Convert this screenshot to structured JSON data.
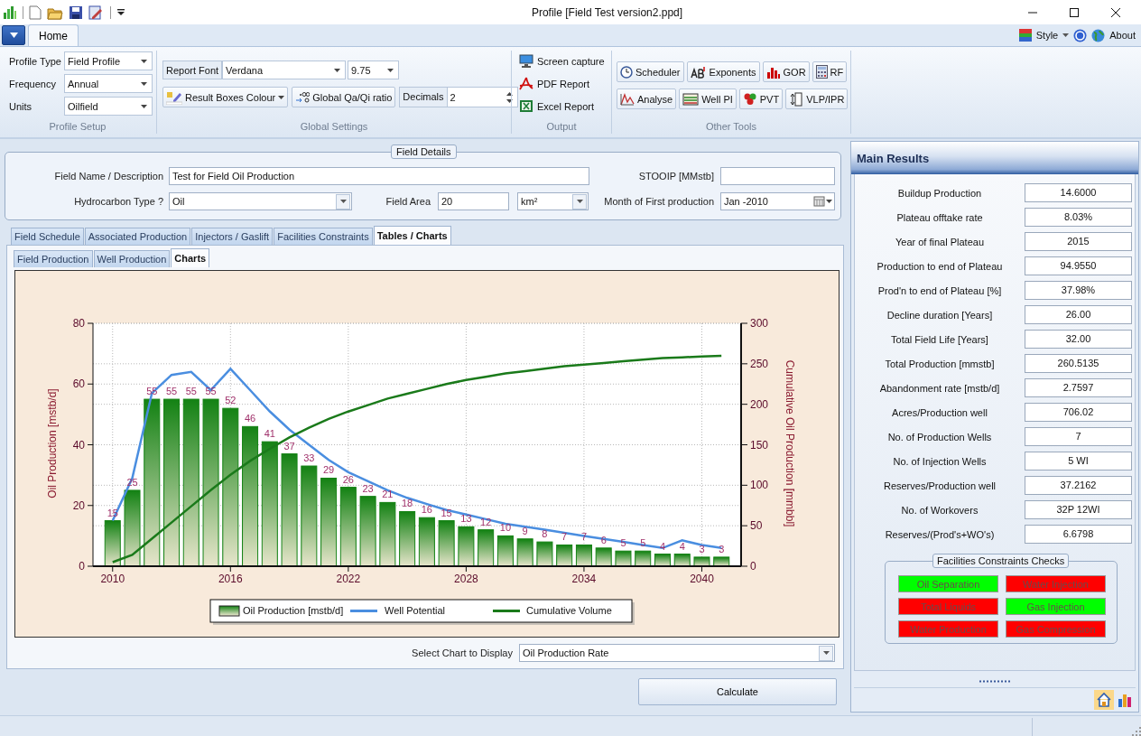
{
  "window": {
    "title": "Profile [Field Test version2.ppd]"
  },
  "ribbon": {
    "tabs": [
      {
        "label": "Home",
        "selected": true
      }
    ],
    "style_menu": {
      "label": "Style"
    },
    "about": {
      "label": "About"
    },
    "profile_setup": {
      "label": "Profile Setup",
      "fields": [
        {
          "label": "Profile Type",
          "value": "Field Profile"
        },
        {
          "label": "Frequency",
          "value": "Annual"
        },
        {
          "label": "Units",
          "value": "Oilfield"
        }
      ]
    },
    "global_settings": {
      "label": "Global Settings",
      "report_font": {
        "label": "Report Font",
        "font": "Verdana",
        "size": "9.75"
      },
      "result_boxes_colour": "Result Boxes Colour",
      "qa_qi_ratio": "Global Qa/Qi ratio",
      "decimals": {
        "label": "Decimals",
        "value": "2"
      }
    },
    "output": {
      "label": "Output",
      "items": [
        "Screen capture",
        "PDF Report",
        "Excel Report"
      ]
    },
    "other_tools": {
      "label": "Other Tools",
      "rows": [
        [
          "Scheduler",
          "Exponents",
          "GOR",
          "RF"
        ],
        [
          "Analyse",
          "Well PI",
          "PVT",
          "VLP/IPR"
        ]
      ]
    }
  },
  "field_details": {
    "title": "Field Details",
    "name": {
      "label": "Field Name / Description",
      "value": "Test for Field Oil Production"
    },
    "stooip": {
      "label": "STOOIP [MMstb]"
    },
    "hydrocarbon": {
      "label": "Hydrocarbon Type ?",
      "value": "Oil"
    },
    "area": {
      "label": "Field Area",
      "value": "20",
      "unit": "km²"
    },
    "first_month": {
      "label": "Month of First production",
      "value": "Jan -2010"
    }
  },
  "tabs": [
    {
      "label": "Field Schedule",
      "selected": false
    },
    {
      "label": "Associated Production",
      "selected": false
    },
    {
      "label": "Injectors / Gaslift",
      "selected": false
    },
    {
      "label": "Facilities Constraints",
      "selected": false
    },
    {
      "label": "Tables / Charts",
      "selected": true
    }
  ],
  "subtabs": [
    {
      "label": "Field Production",
      "selected": false
    },
    {
      "label": "Well Production",
      "selected": false
    },
    {
      "label": "Charts",
      "selected": true
    }
  ],
  "chart": {
    "chart_data": {
      "type": "bar",
      "ylabel": "Oil Production [mstb/d]",
      "y2label": "Cumulative Oil Production [mmbbl]",
      "x": [
        2010,
        2011,
        2012,
        2013,
        2014,
        2015,
        2016,
        2017,
        2018,
        2019,
        2020,
        2021,
        2022,
        2023,
        2024,
        2025,
        2026,
        2027,
        2028,
        2029,
        2030,
        2031,
        2032,
        2033,
        2034,
        2035,
        2036,
        2037,
        2038,
        2039,
        2040,
        2041
      ],
      "xlim": [
        2009,
        2042
      ],
      "xticks": [
        2010,
        2016,
        2022,
        2028,
        2034,
        2040
      ],
      "ylim": [
        0,
        80
      ],
      "yticks": [
        0,
        20,
        40,
        60,
        80
      ],
      "y2lim": [
        0,
        300
      ],
      "y2ticks": [
        0,
        50,
        100,
        150,
        200,
        250,
        300
      ],
      "grid": true,
      "legend": "bottom",
      "series": [
        {
          "name": "Oil Production [mstb/d]",
          "type": "bar",
          "color": "#148214",
          "data_labels": true,
          "values": [
            15,
            25,
            55,
            55,
            55,
            55,
            52,
            46,
            41,
            37,
            33,
            29,
            26,
            23,
            21,
            18,
            16,
            15,
            13,
            12,
            10,
            9,
            8,
            7,
            7,
            6,
            5,
            5,
            4,
            4,
            3,
            3
          ]
        },
        {
          "name": "Well Potential",
          "type": "line",
          "color": "#4a8ee0",
          "values": [
            15,
            29,
            57,
            63,
            64,
            58,
            65,
            58,
            51,
            45,
            40,
            35,
            31,
            28,
            25,
            22.5,
            20.5,
            18.5,
            17,
            15.5,
            14,
            13,
            12,
            11,
            10,
            9,
            8,
            7,
            6,
            8.5,
            7,
            6
          ]
        },
        {
          "name": "Cumulative Volume",
          "type": "line",
          "axis": "y2",
          "color": "#1a7a1a",
          "values": [
            5,
            14,
            34,
            54,
            74,
            94,
            113,
            130,
            145,
            159,
            171,
            182,
            191,
            199,
            207,
            213,
            219,
            225,
            230,
            234,
            238,
            241,
            244,
            247,
            249,
            251,
            253,
            255,
            257,
            258,
            259,
            260
          ]
        }
      ]
    },
    "select": {
      "label": "Select Chart to Display",
      "value": "Oil Production Rate"
    }
  },
  "calculate": "Calculate",
  "main_results": {
    "title": "Main Results",
    "rows": [
      {
        "label": "Buildup Production",
        "value": "14.6000"
      },
      {
        "label": "Plateau offtake rate",
        "value": "8.03%"
      },
      {
        "label": "Year of final Plateau",
        "value": "2015"
      },
      {
        "label": "Production to end of Plateau",
        "value": "94.9550"
      },
      {
        "label": "Prod'n to end of Plateau [%]",
        "value": "37.98%"
      },
      {
        "label": "Decline duration [Years]",
        "value": "26.00"
      },
      {
        "label": "Total Field Life [Years]",
        "value": "32.00"
      },
      {
        "label": "Total Production [mmstb]",
        "value": "260.5135"
      },
      {
        "label": "Abandonment rate [mstb/d]",
        "value": "2.7597"
      },
      {
        "label": "Acres/Production well",
        "value": "706.02"
      },
      {
        "label": "No. of Production Wells",
        "value": "7"
      },
      {
        "label": "No. of Injection Wells",
        "value": "5 WI"
      },
      {
        "label": "Reserves/Production well",
        "value": "37.2162"
      },
      {
        "label": "No. of Workovers",
        "value": "32P 12WI"
      },
      {
        "label": "Reserves/(Prod's+WO's)",
        "value": "6.6798"
      }
    ],
    "checks": {
      "title": "Facilities Constraints Checks",
      "items": [
        {
          "label": "Oil Separation",
          "color": "#00ff00"
        },
        {
          "label": "Water Injection",
          "color": "#ff0000"
        },
        {
          "label": "Total Liquids",
          "color": "#ff0000"
        },
        {
          "label": "Gas Injection",
          "color": "#00ff00"
        },
        {
          "label": "Water Production",
          "color": "#ff0000"
        },
        {
          "label": "Gas Compression",
          "color": "#ff0000"
        }
      ]
    }
  }
}
